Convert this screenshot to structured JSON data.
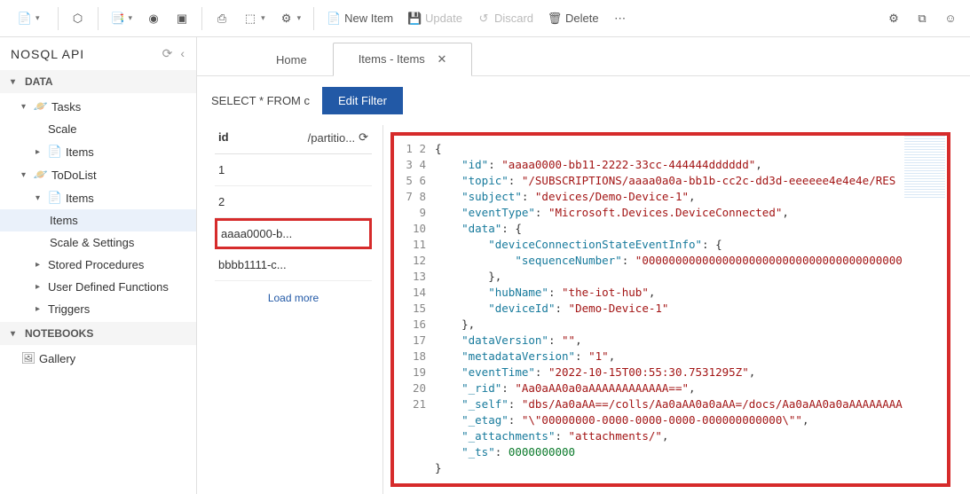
{
  "toolbar": {
    "new_item": "New Item",
    "update": "Update",
    "discard": "Discard",
    "delete": "Delete"
  },
  "sidebar": {
    "title": "NOSQL API",
    "data_section": "DATA",
    "notebooks_section": "NOTEBOOKS",
    "tree": {
      "tasks": "Tasks",
      "scale": "Scale",
      "items1": "Items",
      "todolist": "ToDoList",
      "items2": "Items",
      "items3": "Items",
      "scale_settings": "Scale & Settings",
      "stored_proc": "Stored Procedures",
      "udf": "User Defined Functions",
      "triggers": "Triggers",
      "gallery": "Gallery"
    }
  },
  "tabs": {
    "home": "Home",
    "items": "Items - Items"
  },
  "query": {
    "text": "SELECT * FROM c",
    "button": "Edit Filter"
  },
  "item_list": {
    "header_id": "id",
    "header_part": "/partitio...",
    "rows": [
      "1",
      "2",
      "aaaa0000-b...",
      "bbbb1111-c..."
    ],
    "load_more": "Load more"
  },
  "code_lines": [
    [
      [
        "punc",
        "{"
      ]
    ],
    [
      [
        "pad",
        "    "
      ],
      [
        "key",
        "\"id\""
      ],
      [
        "punc",
        ": "
      ],
      [
        "str",
        "\"aaaa0000-bb11-2222-33cc-444444dddddd\""
      ],
      [
        "punc",
        ","
      ]
    ],
    [
      [
        "pad",
        "    "
      ],
      [
        "key",
        "\"topic\""
      ],
      [
        "punc",
        ": "
      ],
      [
        "str",
        "\"/SUBSCRIPTIONS/aaaa0a0a-bb1b-cc2c-dd3d-eeeeee4e4e4e/RES"
      ]
    ],
    [
      [
        "pad",
        "    "
      ],
      [
        "key",
        "\"subject\""
      ],
      [
        "punc",
        ": "
      ],
      [
        "str",
        "\"devices/Demo-Device-1\""
      ],
      [
        "punc",
        ","
      ]
    ],
    [
      [
        "pad",
        "    "
      ],
      [
        "key",
        "\"eventType\""
      ],
      [
        "punc",
        ": "
      ],
      [
        "str",
        "\"Microsoft.Devices.DeviceConnected\""
      ],
      [
        "punc",
        ","
      ]
    ],
    [
      [
        "pad",
        "    "
      ],
      [
        "key",
        "\"data\""
      ],
      [
        "punc",
        ": {"
      ]
    ],
    [
      [
        "pad",
        "        "
      ],
      [
        "key",
        "\"deviceConnectionStateEventInfo\""
      ],
      [
        "punc",
        ": {"
      ]
    ],
    [
      [
        "pad",
        "            "
      ],
      [
        "key",
        "\"sequenceNumber\""
      ],
      [
        "punc",
        ": "
      ],
      [
        "str",
        "\"000000000000000000000000000000000000000"
      ]
    ],
    [
      [
        "pad",
        "        "
      ],
      [
        "punc",
        "},"
      ]
    ],
    [
      [
        "pad",
        "        "
      ],
      [
        "key",
        "\"hubName\""
      ],
      [
        "punc",
        ": "
      ],
      [
        "str",
        "\"the-iot-hub\""
      ],
      [
        "punc",
        ","
      ]
    ],
    [
      [
        "pad",
        "        "
      ],
      [
        "key",
        "\"deviceId\""
      ],
      [
        "punc",
        ": "
      ],
      [
        "str",
        "\"Demo-Device-1\""
      ]
    ],
    [
      [
        "pad",
        "    "
      ],
      [
        "punc",
        "},"
      ]
    ],
    [
      [
        "pad",
        "    "
      ],
      [
        "key",
        "\"dataVersion\""
      ],
      [
        "punc",
        ": "
      ],
      [
        "str",
        "\"\""
      ],
      [
        "punc",
        ","
      ]
    ],
    [
      [
        "pad",
        "    "
      ],
      [
        "key",
        "\"metadataVersion\""
      ],
      [
        "punc",
        ": "
      ],
      [
        "str",
        "\"1\""
      ],
      [
        "punc",
        ","
      ]
    ],
    [
      [
        "pad",
        "    "
      ],
      [
        "key",
        "\"eventTime\""
      ],
      [
        "punc",
        ": "
      ],
      [
        "str",
        "\"2022-10-15T00:55:30.7531295Z\""
      ],
      [
        "punc",
        ","
      ]
    ],
    [
      [
        "pad",
        "    "
      ],
      [
        "key",
        "\"_rid\""
      ],
      [
        "punc",
        ": "
      ],
      [
        "str",
        "\"Aa0aAA0a0aAAAAAAAAAAAA==\""
      ],
      [
        "punc",
        ","
      ]
    ],
    [
      [
        "pad",
        "    "
      ],
      [
        "key",
        "\"_self\""
      ],
      [
        "punc",
        ": "
      ],
      [
        "str",
        "\"dbs/Aa0aAA==/colls/Aa0aAA0a0aAA=/docs/Aa0aAA0a0aAAAAAAAA"
      ]
    ],
    [
      [
        "pad",
        "    "
      ],
      [
        "key",
        "\"_etag\""
      ],
      [
        "punc",
        ": "
      ],
      [
        "str",
        "\"\\\"00000000-0000-0000-0000-000000000000\\\"\""
      ],
      [
        "punc",
        ","
      ]
    ],
    [
      [
        "pad",
        "    "
      ],
      [
        "key",
        "\"_attachments\""
      ],
      [
        "punc",
        ": "
      ],
      [
        "str",
        "\"attachments/\""
      ],
      [
        "punc",
        ","
      ]
    ],
    [
      [
        "pad",
        "    "
      ],
      [
        "key",
        "\"_ts\""
      ],
      [
        "punc",
        ": "
      ],
      [
        "num",
        "0000000000"
      ]
    ],
    [
      [
        "punc",
        "}"
      ]
    ]
  ]
}
